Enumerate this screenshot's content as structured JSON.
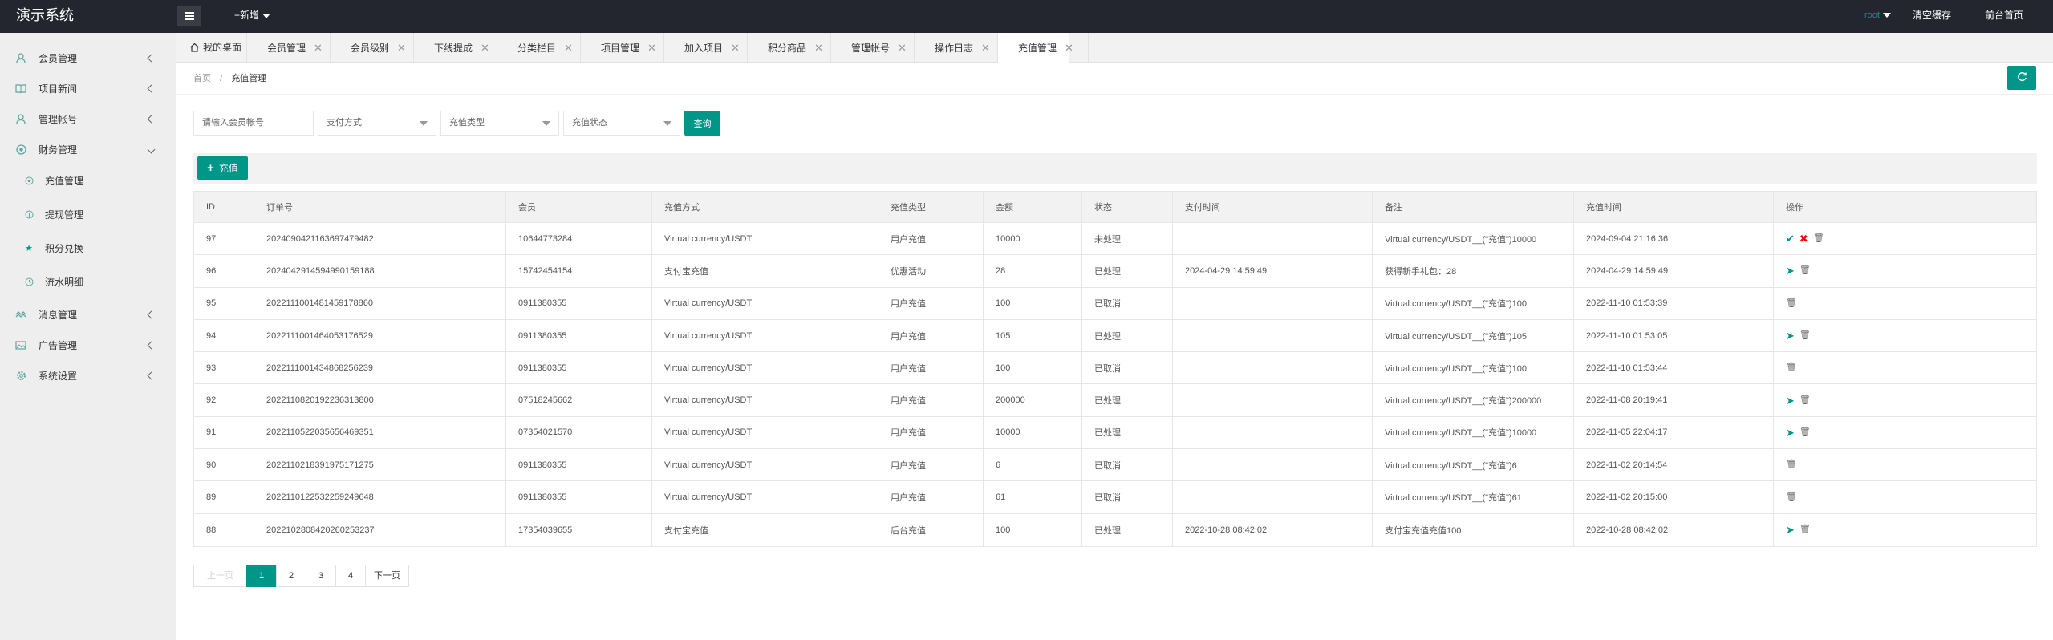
{
  "app": {
    "title": "演示系统"
  },
  "header": {
    "add_new": "+新增",
    "user": "root",
    "clear_cache": "清空缓存",
    "front_home": "前台首页"
  },
  "sidebar": {
    "items": [
      {
        "label": "会员管理",
        "icon": "user-icon"
      },
      {
        "label": "项目新闻",
        "icon": "book-icon"
      },
      {
        "label": "管理帐号",
        "icon": "admin-icon"
      },
      {
        "label": "财务管理",
        "icon": "finance-icon",
        "expanded": true,
        "children": [
          {
            "label": "充值管理",
            "icon": "recharge-icon"
          },
          {
            "label": "提现管理",
            "icon": "withdraw-icon"
          },
          {
            "label": "积分兑换",
            "icon": "star-icon"
          },
          {
            "label": "流水明细",
            "icon": "clock-icon"
          }
        ]
      },
      {
        "label": "消息管理",
        "icon": "message-icon"
      },
      {
        "label": "广告管理",
        "icon": "image-icon"
      },
      {
        "label": "系统设置",
        "icon": "settings-icon"
      }
    ]
  },
  "tabs": [
    {
      "label": "我的桌面",
      "icon": "home-icon"
    },
    {
      "label": "会员管理"
    },
    {
      "label": "会员级别"
    },
    {
      "label": "下线提成"
    },
    {
      "label": "分类栏目"
    },
    {
      "label": "项目管理"
    },
    {
      "label": "加入项目"
    },
    {
      "label": "积分商品"
    },
    {
      "label": "管理帐号"
    },
    {
      "label": "操作日志"
    },
    {
      "label": "充值管理",
      "active": true
    }
  ],
  "breadcrumb": {
    "home": "首页",
    "sep": "/",
    "current": "充值管理"
  },
  "filters": {
    "account_placeholder": "请输入会员帐号",
    "pay_method": "支付方式",
    "recharge_type": "充值类型",
    "recharge_status": "充值状态",
    "query": "查询"
  },
  "toolbar": {
    "recharge": "充值"
  },
  "table": {
    "headers": [
      "ID",
      "订单号",
      "会员",
      "充值方式",
      "充值类型",
      "金额",
      "状态",
      "支付时间",
      "备注",
      "充值时间",
      "操作"
    ],
    "rows": [
      [
        "97",
        "2024090421163697479482",
        "10644773284",
        "Virtual currency/USDT",
        "用户充值",
        "10000",
        "未处理",
        "",
        "Virtual currency/USDT__(\"充值\")10000",
        "2024-09-04 21:16:36"
      ],
      [
        "96",
        "20240429145949901591​88",
        "15742454154",
        "支付宝充值",
        "优惠活动",
        "28",
        "已处理",
        "2024-04-29 14:59:49",
        "获得新手礼包：28",
        "2024-04-29 14:59:49"
      ],
      [
        "95",
        "2022111001481459178860",
        "0911380355",
        "Virtual currency/USDT",
        "用户充值",
        "100",
        "已取消",
        "",
        "Virtual currency/USDT__(\"充值\")100",
        "2022-11-10 01:53:39"
      ],
      [
        "94",
        "2022111001464053176529",
        "0911380355",
        "Virtual currency/USDT",
        "用户充值",
        "105",
        "已处理",
        "",
        "Virtual currency/USDT__(\"充值\")105",
        "2022-11-10 01:53:05"
      ],
      [
        "93",
        "2022111001434868256239",
        "0911380355",
        "Virtual currency/USDT",
        "用户充值",
        "100",
        "已取消",
        "",
        "Virtual currency/USDT__(\"充值\")100",
        "2022-11-10 01:53:44"
      ],
      [
        "92",
        "2022110820192236313800",
        "07518245662",
        "Virtual currency/USDT",
        "用户充值",
        "200000",
        "已处理",
        "",
        "Virtual currency/USDT__(\"充值\")200000",
        "2022-11-08 20:19:41"
      ],
      [
        "91",
        "2022110522035656469351",
        "07354021570",
        "Virtual currency/USDT",
        "用户充值",
        "10000",
        "已处理",
        "",
        "Virtual currency/USDT__(\"充值\")10000",
        "2022-11-05 22:04:17"
      ],
      [
        "90",
        "2022110218391975171275",
        "0911380355",
        "Virtual currency/USDT",
        "用户充值",
        "6",
        "已取消",
        "",
        "Virtual currency/USDT__(\"充值\")6",
        "2022-11-02 20:14:54"
      ],
      [
        "89",
        "2022110122532259249648",
        "0911380355",
        "Virtual currency/USDT",
        "用户充值",
        "61",
        "已取消",
        "",
        "Virtual currency/USDT__(\"充值\")61",
        "2022-11-02 20:15:00"
      ],
      [
        "88",
        "2022102808420260253237",
        "17354039655",
        "支付宝充值",
        "后台充值",
        "100",
        "已处理",
        "2022-10-28 08:42:02",
        "支付宝充值充值100",
        "2022-10-28 08:42:02"
      ]
    ],
    "row_actions": [
      [
        "approve-icon",
        "reject-icon",
        "delete-icon"
      ],
      [
        "send-icon",
        "delete-icon"
      ],
      [
        "delete-icon"
      ],
      [
        "send-icon",
        "delete-icon"
      ],
      [
        "delete-icon"
      ],
      [
        "send-icon",
        "delete-icon"
      ],
      [
        "send-icon",
        "delete-icon"
      ],
      [
        "delete-icon"
      ],
      [
        "delete-icon"
      ],
      [
        "send-icon",
        "delete-icon"
      ]
    ]
  },
  "pagination": {
    "prev": "上一页",
    "pages": [
      "1",
      "2",
      "3",
      "4"
    ],
    "current": "1",
    "next": "下一页"
  },
  "colors": {
    "accent": "#009688",
    "header_bg": "#23262e",
    "reject": "#ff0000"
  }
}
